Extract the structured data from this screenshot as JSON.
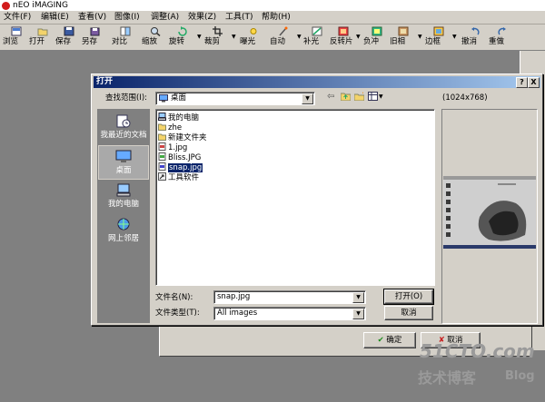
{
  "app": {
    "title": "nEO iMAGING"
  },
  "menu": [
    "文件(F)",
    "编辑(E)",
    "查看(V)",
    "图像(I)",
    "调整(A)",
    "效果(Z)",
    "工具(T)",
    "帮助(H)"
  ],
  "toolbar": [
    {
      "label": "浏览",
      "icon": "browse-icon"
    },
    {
      "label": "打开",
      "icon": "open-icon"
    },
    {
      "label": "保存",
      "icon": "save-icon"
    },
    {
      "label": "另存",
      "icon": "save-as-icon"
    },
    {
      "label": "对比",
      "icon": "compare-icon"
    },
    {
      "label": "缩放",
      "icon": "zoom-icon"
    },
    {
      "label": "旋转",
      "icon": "rotate-icon"
    },
    {
      "label": "裁剪",
      "icon": "crop-icon"
    },
    {
      "label": "曝光",
      "icon": "exposure-icon"
    },
    {
      "label": "自动",
      "icon": "auto-icon"
    },
    {
      "label": "补光",
      "icon": "fill-light-icon"
    },
    {
      "label": "反转片",
      "icon": "slide-film-icon"
    },
    {
      "label": "负冲",
      "icon": "cross-process-icon"
    },
    {
      "label": "旧相",
      "icon": "old-photo-icon"
    },
    {
      "label": "边框",
      "icon": "frame-icon"
    },
    {
      "label": "撤消",
      "icon": "undo-icon"
    },
    {
      "label": "重做",
      "icon": "redo-icon"
    }
  ],
  "dialog": {
    "title": "打开",
    "help_btn": "?",
    "close_btn": "X",
    "lookin_label": "查找范围(I):",
    "lookin_value": "桌面",
    "preview_size": "(1024x768)",
    "places": [
      {
        "label": "我最近的文档",
        "icon": "recent-docs-icon"
      },
      {
        "label": "桌面",
        "icon": "desktop-icon"
      },
      {
        "label": "我的电脑",
        "icon": "my-computer-icon"
      },
      {
        "label": "网上邻居",
        "icon": "network-icon"
      }
    ],
    "files": [
      {
        "name": "我的电脑",
        "icon": "computer-icon"
      },
      {
        "name": "zhe",
        "icon": "folder-icon"
      },
      {
        "name": "新建文件夹",
        "icon": "folder-icon"
      },
      {
        "name": "1.jpg",
        "icon": "image-file-icon"
      },
      {
        "name": "Bliss.JPG",
        "icon": "image-file-icon"
      },
      {
        "name": "snap.jpg",
        "icon": "image-file-icon"
      },
      {
        "name": "工具软件",
        "icon": "shortcut-icon"
      }
    ],
    "selected_file": "snap.jpg",
    "filename_label": "文件名(N):",
    "filename_value": "snap.jpg",
    "filetype_label": "文件类型(T):",
    "filetype_value": "All images",
    "open_btn": "打开(O)",
    "cancel_btn": "取消"
  },
  "bg_dialog": {
    "ok_btn": "确定",
    "cancel_btn": "取消"
  },
  "watermark": {
    "site": "51CTO.com",
    "sub": "技术博客",
    "blog": "Blog"
  }
}
